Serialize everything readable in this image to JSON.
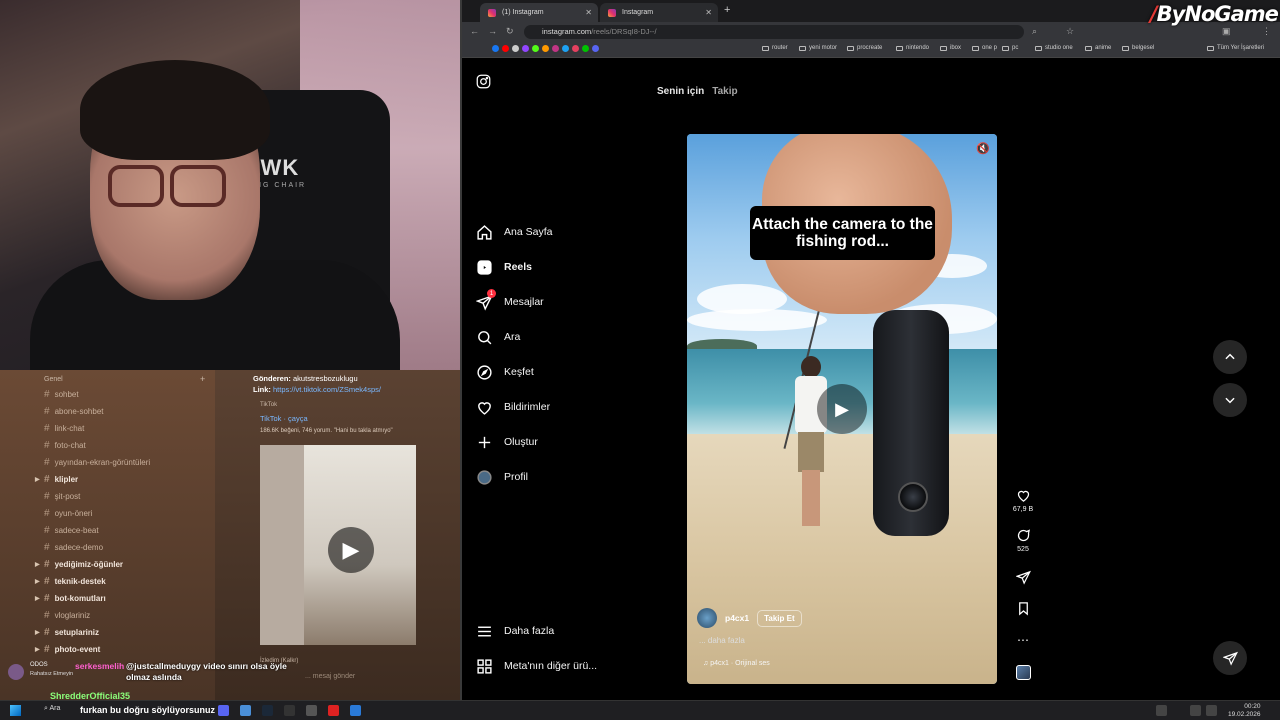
{
  "watermark": "ByNoGame",
  "webcam": {
    "chair_brand": "HAWK",
    "chair_sub": "GAMING CHAIR"
  },
  "discord": {
    "category": "Genel",
    "channels": [
      {
        "name": "sohbet",
        "type": "channel"
      },
      {
        "name": "abone-sohbet",
        "type": "channel"
      },
      {
        "name": "link-chat",
        "type": "channel"
      },
      {
        "name": "foto-chat",
        "type": "channel"
      },
      {
        "name": "yayından-ekran-görüntüleri",
        "type": "channel"
      },
      {
        "name": "klipler",
        "type": "category"
      },
      {
        "name": "şit-post",
        "type": "channel"
      },
      {
        "name": "oyun-öneri",
        "type": "channel"
      },
      {
        "name": "sadece-beat",
        "type": "channel"
      },
      {
        "name": "sadece-demo",
        "type": "channel"
      },
      {
        "name": "yediğimiz-öğünler",
        "type": "category"
      },
      {
        "name": "teknik-destek",
        "type": "category"
      },
      {
        "name": "bot-komutları",
        "type": "category"
      },
      {
        "name": "vloglariniz",
        "type": "channel"
      },
      {
        "name": "setuplariniz",
        "type": "category"
      },
      {
        "name": "photo-event",
        "type": "category"
      }
    ],
    "post": {
      "sender_label": "Gönderen:",
      "sender": "akutstresbozuklugu",
      "link_label": "Link:",
      "link": "https://vt.tiktok.com/ZSmek4sps/",
      "embed_site": "TikTok",
      "embed_title": "TikTok · çayça",
      "embed_desc": "186.6K beğeni, 746 yorum. \"Hani bu takla atmıyo\"",
      "footer": "İzledim (Kalkr)"
    },
    "input_placeholder": "... mesaj gönder",
    "overlay": {
      "user1": "serkesmelih",
      "msg1": "@justcallmeduygy video sınırı olsa öyle olmaz aslında",
      "small_user": "Rahatsız Etmeyin",
      "small_tag": "ODOS",
      "user2": "ShredderOfficial35",
      "msg2": "furkan bu doğru söylüyorsunuz"
    }
  },
  "browser": {
    "tabs": [
      {
        "label": "(1) Instagram",
        "active": true
      },
      {
        "label": "Instagram",
        "active": false
      }
    ],
    "url_host": "instagram.com",
    "url_path": "/reels/DRSqI8-DJ--/",
    "bookmarks": [
      "router",
      "yeni motor",
      "procreate",
      "nintendo",
      "ibox",
      "one p",
      "pc",
      "studio one",
      "anime",
      "belgesel",
      "Tüm Yer İşaretleri"
    ]
  },
  "instagram": {
    "feed_tabs": [
      "Senin için",
      "Takip"
    ],
    "nav": [
      {
        "label": "Ana Sayfa",
        "icon": "home-icon"
      },
      {
        "label": "Reels",
        "icon": "reels-icon",
        "active": true
      },
      {
        "label": "Mesajlar",
        "icon": "messenger-icon",
        "badge": "1"
      },
      {
        "label": "Ara",
        "icon": "search-icon"
      },
      {
        "label": "Keşfet",
        "icon": "compass-icon"
      },
      {
        "label": "Bildirimler",
        "icon": "heart-icon"
      },
      {
        "label": "Oluştur",
        "icon": "plus-icon"
      },
      {
        "label": "Profil",
        "icon": "avatar-icon"
      }
    ],
    "more": "Daha fazla",
    "meta": "Meta'nın diğer ürü...",
    "reel": {
      "caption": "Attach the camera to the fishing rod...",
      "author": "p4cx1",
      "follow": "Takip Et",
      "more": "... daha fazla",
      "audio": "p4cx1 · Orijinal ses",
      "likes": "67,9 B",
      "comments": "525"
    }
  },
  "taskbar": {
    "search": "Ara",
    "time": "00:20",
    "date": "19.02.2026"
  }
}
